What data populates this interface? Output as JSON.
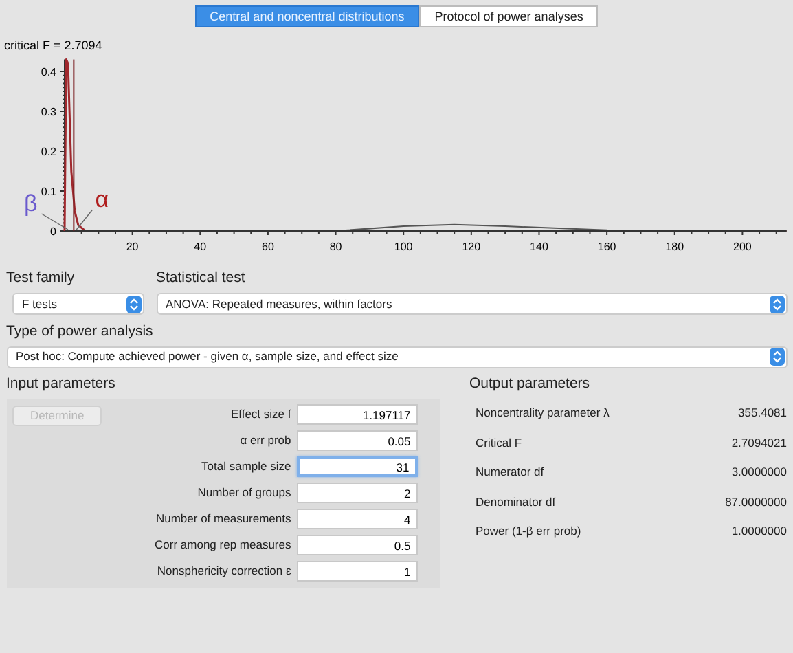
{
  "tabs": [
    {
      "label": "Central and noncentral distributions",
      "selected": true
    },
    {
      "label": "Protocol of power analyses",
      "selected": false
    }
  ],
  "plot": {
    "chart_data": {
      "type": "line",
      "title": "critical F = 2.7094",
      "x": [
        0,
        0.5,
        1,
        2,
        3,
        4,
        6,
        10,
        80,
        100,
        115,
        130,
        160,
        213
      ],
      "series": [
        {
          "color": "#a0282d",
          "values": [
            0,
            0.43,
            0.42,
            0.15,
            0.05,
            0.015,
            0.001,
            0,
            0,
            0,
            0,
            0,
            0,
            0
          ]
        },
        {
          "color": "#555555",
          "values": [
            0,
            0,
            0,
            0,
            0,
            0,
            0,
            0,
            0,
            0.012,
            0.016,
            0.012,
            0.002,
            0
          ]
        }
      ],
      "xlim": [
        0,
        213
      ],
      "ylim": [
        0,
        0.43
      ],
      "xticks": [
        20,
        40,
        60,
        80,
        100,
        120,
        140,
        160,
        180,
        200
      ],
      "yticks": [
        0,
        0.1,
        0.2,
        0.3,
        0.4
      ],
      "ref_lines": [
        {
          "axis": "x",
          "value": 2.7094
        }
      ],
      "annotations": [
        "β",
        "α"
      ]
    }
  },
  "test_family": {
    "label": "Test family",
    "value": "F tests"
  },
  "statistical_test": {
    "label": "Statistical test",
    "value": "ANOVA: Repeated measures, within factors"
  },
  "power_analysis": {
    "label": "Type of power analysis",
    "value": "Post hoc: Compute achieved power - given α, sample size, and effect size"
  },
  "input_parameters": {
    "title": "Input parameters",
    "determine": {
      "label": "Determine",
      "disabled": true
    },
    "rows": [
      {
        "label": "Effect size f",
        "value": "1.197117",
        "focused": false
      },
      {
        "label": "α err prob",
        "value": "0.05",
        "focused": false
      },
      {
        "label": "Total sample size",
        "value": "31",
        "focused": true
      },
      {
        "label": "Number of groups",
        "value": "2",
        "focused": false
      },
      {
        "label": "Number of measurements",
        "value": "4",
        "focused": false
      },
      {
        "label": "Corr among rep measures",
        "value": "0.5",
        "focused": false
      },
      {
        "label": "Nonsphericity correction ε",
        "value": "1",
        "focused": false
      }
    ]
  },
  "output_parameters": {
    "title": "Output parameters",
    "rows": [
      {
        "label": "Noncentrality parameter λ",
        "value": "355.4081"
      },
      {
        "label": "Critical F",
        "value": "2.7094021"
      },
      {
        "label": "Numerator df",
        "value": "3.0000000"
      },
      {
        "label": "Denominator df",
        "value": "87.0000000"
      },
      {
        "label": "Power (1-β err prob)",
        "value": "1.0000000"
      }
    ]
  }
}
